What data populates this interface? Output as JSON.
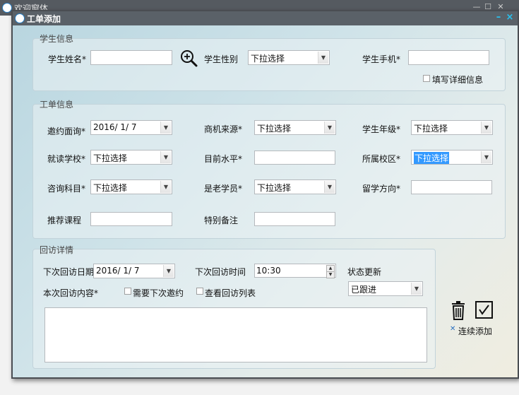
{
  "background_window": {
    "title": "欢迎窗体"
  },
  "dialog": {
    "title": "工单添加"
  },
  "student_info": {
    "title": "学生信息",
    "name_label": "学生姓名*",
    "name_value": "",
    "gender_label": "学生性别",
    "gender_value": "下拉选择",
    "phone_label": "学生手机*",
    "phone_value": "",
    "detail_checkbox_label": "填写详细信息"
  },
  "ticket_info": {
    "title": "工单信息",
    "interview_label": "邀约面询*",
    "interview_date": "2016/  1/  7",
    "source_label": "商机来源*",
    "source_value": "下拉选择",
    "grade_label": "学生年级*",
    "grade_value": "下拉选择",
    "school_label": "就读学校*",
    "school_value": "下拉选择",
    "level_label": "目前水平*",
    "level_value": "",
    "campus_label": "所属校区*",
    "campus_value": "下拉选择",
    "subject_label": "咨询科目*",
    "subject_value": "下拉选择",
    "old_student_label": "是老学员*",
    "old_student_value": "下拉选择",
    "abroad_label": "留学方向*",
    "abroad_value": "",
    "course_label": "推荐课程",
    "course_value": "",
    "remark_label": "特别备注",
    "remark_value": ""
  },
  "visit_info": {
    "title": "回访详情",
    "next_date_label": "下次回访日期",
    "next_date_value": "2016/  1/  7",
    "next_time_label": "下次回访时间",
    "next_time_value": "10:30",
    "status_label": "状态更新",
    "status_value": "已跟进",
    "content_label": "本次回访内容*",
    "need_invite_label": "需要下次邀约",
    "view_list_label": "查看回访列表",
    "content_value": ""
  },
  "actions": {
    "continue_add_label": "连续添加"
  }
}
